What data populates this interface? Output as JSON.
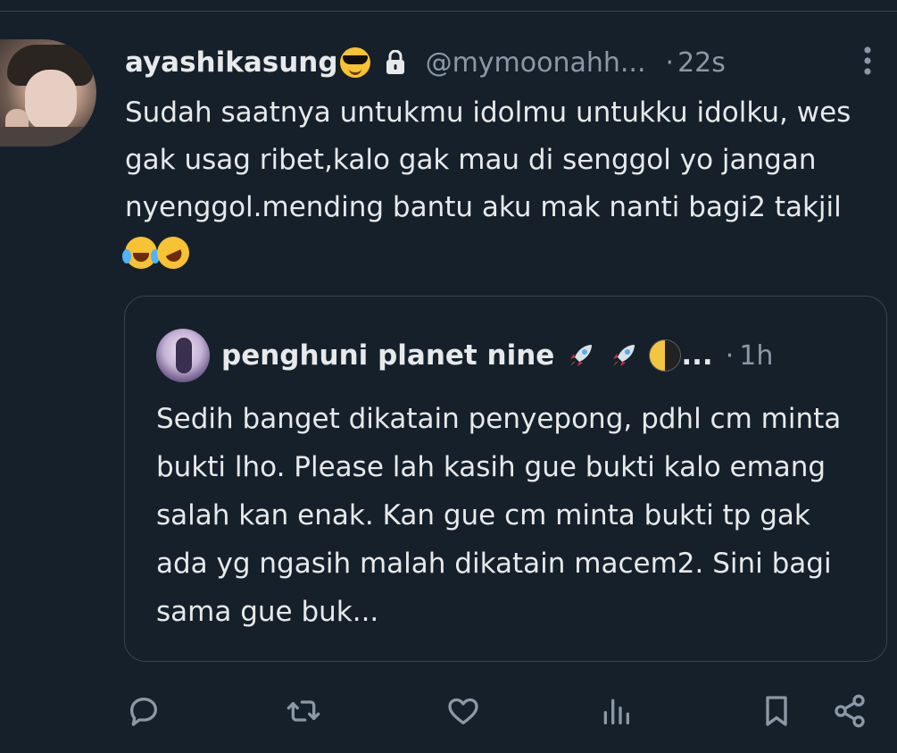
{
  "tweet": {
    "display_name": "ayashikasung",
    "handle": "@mymoonahh...",
    "dot": "·",
    "time": "22s",
    "text": "Sudah saatnya untukmu idolmu untukku idolku, wes gak usag ribet,kalo gak mau di senggol yo jangan nyenggol.mending bantu aku mak nanti bagi2 takjil",
    "emoji_after_name": "smiling-face-with-sunglasses",
    "emoji_after_text": [
      "face-with-tears-of-joy",
      "rolling-on-the-floor-laughing"
    ]
  },
  "quote": {
    "display_name": "penghuni planet nine",
    "name_emojis": [
      "rocket",
      "rocket",
      "last-quarter-moon"
    ],
    "name_ellipsis": "...",
    "dot": "·",
    "time": "1h",
    "text": "Sedih banget dikatain penyepong, pdhl cm minta bukti lho. Please lah kasih gue bukti kalo emang salah kan enak. Kan gue cm minta bukti tp gak ada yg ngasih malah dikatain macem2. Sini bagi sama gue buk..."
  },
  "actions": [
    "reply-icon",
    "retweet-icon",
    "like-icon",
    "views-icon",
    "bookmark-icon",
    "share-icon"
  ],
  "colors": {
    "background": "#15202b",
    "text": "#e7e9ea",
    "muted": "#8b98a5",
    "border": "#38444d"
  }
}
